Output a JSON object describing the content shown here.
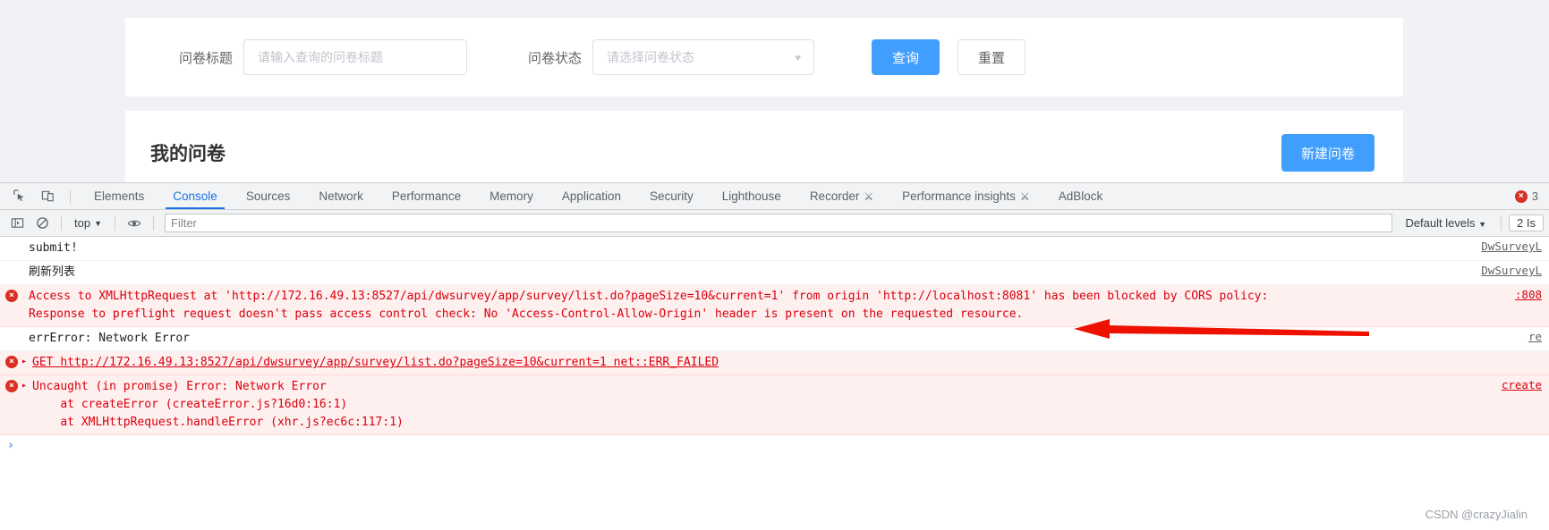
{
  "page": {
    "filter_bar": {
      "title_label": "问卷标题",
      "title_placeholder": "请输入查询的问卷标题",
      "status_label": "问卷状态",
      "status_placeholder": "请选择问卷状态",
      "search_button": "查询",
      "reset_button": "重置",
      "caret_icon": "chevron-down-icon"
    },
    "list_card": {
      "heading": "我的问卷",
      "new_button": "新建问卷"
    }
  },
  "devtools": {
    "left_icons": [
      {
        "name": "inspect-element-icon",
        "glyph": "↖"
      },
      {
        "name": "device-toolbar-icon",
        "glyph": "▢"
      }
    ],
    "tabs": [
      {
        "label": "Elements",
        "active": false,
        "flask": false
      },
      {
        "label": "Console",
        "active": true,
        "flask": false
      },
      {
        "label": "Sources",
        "active": false,
        "flask": false
      },
      {
        "label": "Network",
        "active": false,
        "flask": false
      },
      {
        "label": "Performance",
        "active": false,
        "flask": false
      },
      {
        "label": "Memory",
        "active": false,
        "flask": false
      },
      {
        "label": "Application",
        "active": false,
        "flask": false
      },
      {
        "label": "Security",
        "active": false,
        "flask": false
      },
      {
        "label": "Lighthouse",
        "active": false,
        "flask": false
      },
      {
        "label": "Recorder",
        "active": false,
        "flask": true
      },
      {
        "label": "Performance insights",
        "active": false,
        "flask": true
      },
      {
        "label": "AdBlock",
        "active": false,
        "flask": false
      }
    ],
    "error_count": "3",
    "toolbar": {
      "sidebar_icon": "console-sidebar-icon",
      "clear_icon": "clear-console-icon",
      "context": "top",
      "context_caret": "▼",
      "eye_icon": "live-expression-eye-icon",
      "filter_placeholder": "Filter",
      "levels_label": "Default levels",
      "levels_caret": "▼",
      "issues_label": "2 Is"
    },
    "messages": [
      {
        "kind": "plain",
        "expandable": false,
        "text": "submit!",
        "source": "DwSurveyL"
      },
      {
        "kind": "plain",
        "expandable": false,
        "text": "刷新列表",
        "source": "DwSurveyL"
      },
      {
        "kind": "error",
        "expandable": false,
        "text": "Access to XMLHttpRequest at 'http://172.16.49.13:8527/api/dwsurvey/app/survey/list.do?pageSize=10&current=1' from origin 'http://localhost:8081' has been blocked by CORS policy:\nResponse to preflight request doesn't pass access control check: No 'Access-Control-Allow-Origin' header is present on the requested resource.",
        "source": ":808"
      },
      {
        "kind": "plain",
        "expandable": false,
        "text": "errError: Network Error",
        "source": "re"
      },
      {
        "kind": "error",
        "expandable": true,
        "text": "GET http://172.16.49.13:8527/api/dwsurvey/app/survey/list.do?pageSize=10&current=1 net::ERR_FAILED",
        "source": ""
      },
      {
        "kind": "error",
        "expandable": true,
        "text": "Uncaught (in promise) Error: Network Error\n    at createError (createError.js?16d0:16:1)\n    at XMLHttpRequest.handleError (xhr.js?ec6c:117:1)",
        "source": "create"
      }
    ],
    "prompt_glyph": "›"
  },
  "watermark": "CSDN @crazyJialin",
  "colors": {
    "accent_blue": "#409eff",
    "devtools_blue": "#1a73e8",
    "error_red": "#d8000c",
    "error_bg": "#fff0f0",
    "annotation_red": "#ee1100"
  }
}
